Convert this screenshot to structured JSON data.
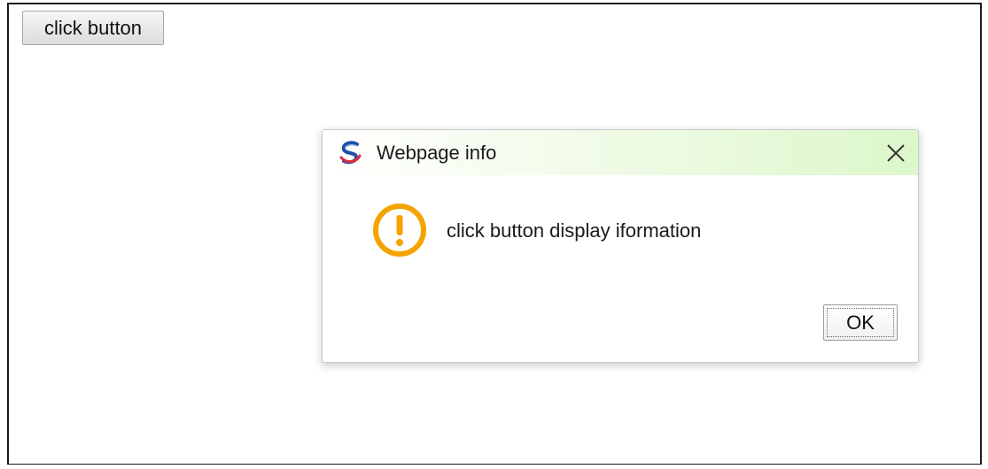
{
  "page": {
    "button_label": "click button"
  },
  "dialog": {
    "title": "Webpage info",
    "message": "click button display iformation",
    "ok_label": "OK",
    "icons": {
      "logo": "browser-logo-icon",
      "close": "close-icon",
      "warning": "warning-icon"
    }
  },
  "colors": {
    "titlebar_tint": "#dcf7cb",
    "warning_orange": "#f5a300",
    "logo_blue": "#1f4fa8",
    "logo_red": "#e02b3c"
  }
}
